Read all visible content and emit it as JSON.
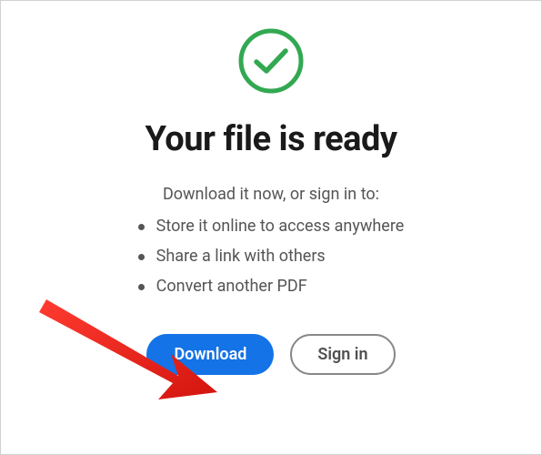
{
  "icon": "checkmark-circle",
  "title": "Your file is ready",
  "subtitle": "Download it now, or sign in to:",
  "benefits": [
    "Store it online to access anywhere",
    "Share a link with others",
    "Convert another PDF"
  ],
  "buttons": {
    "download": "Download",
    "signin": "Sign in"
  },
  "colors": {
    "success": "#33a852",
    "primary": "#1473e6",
    "annotation": "#e8201c"
  }
}
